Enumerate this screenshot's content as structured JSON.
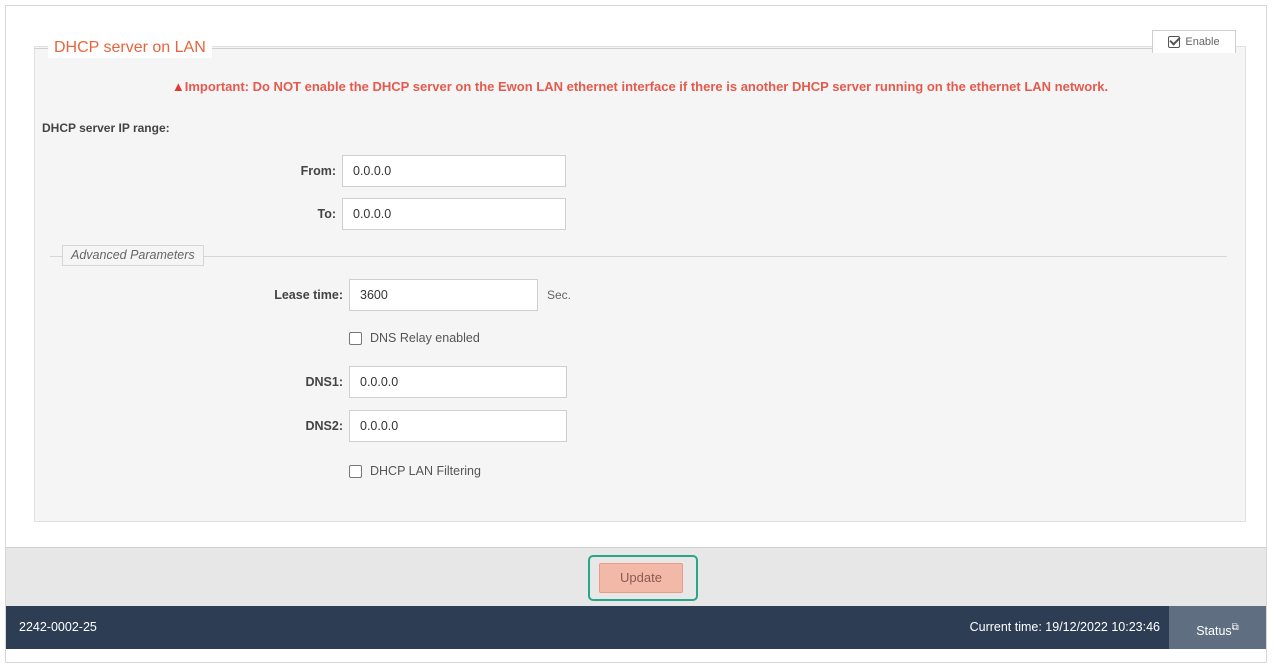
{
  "dhcp": {
    "legend": "DHCP server on LAN",
    "enable_label": "Enable",
    "enabled": true,
    "warning": "Important: Do NOT enable the DHCP server on the Ewon LAN ethernet interface if there is another DHCP server running on the ethernet LAN network.",
    "range_label": "DHCP server IP range:",
    "from_label": "From:",
    "from_value": "0.0.0.0",
    "to_label": "To:",
    "to_value": "0.0.0.0"
  },
  "advanced": {
    "legend": "Advanced Parameters",
    "lease_label": "Lease time:",
    "lease_value": "3600",
    "lease_unit": "Sec.",
    "dns_relay_label": "DNS Relay enabled",
    "dns_relay_checked": false,
    "dns1_label": "DNS1:",
    "dns1_value": "0.0.0.0",
    "dns2_label": "DNS2:",
    "dns2_value": "0.0.0.0",
    "lan_filtering_label": "DHCP LAN Filtering",
    "lan_filtering_checked": false
  },
  "actions": {
    "update_label": "Update"
  },
  "footer": {
    "serial": "2242-0002-25",
    "current_time": "Current time: 19/12/2022 10:23:46",
    "status_label": "Status"
  },
  "colors": {
    "legend": "#e8643c",
    "warning": "#e55a4e",
    "update_button": "#f3b9a8",
    "highlight": "#2aa58a",
    "footer": "#2d3e54",
    "status_button": "#5f6e80"
  }
}
